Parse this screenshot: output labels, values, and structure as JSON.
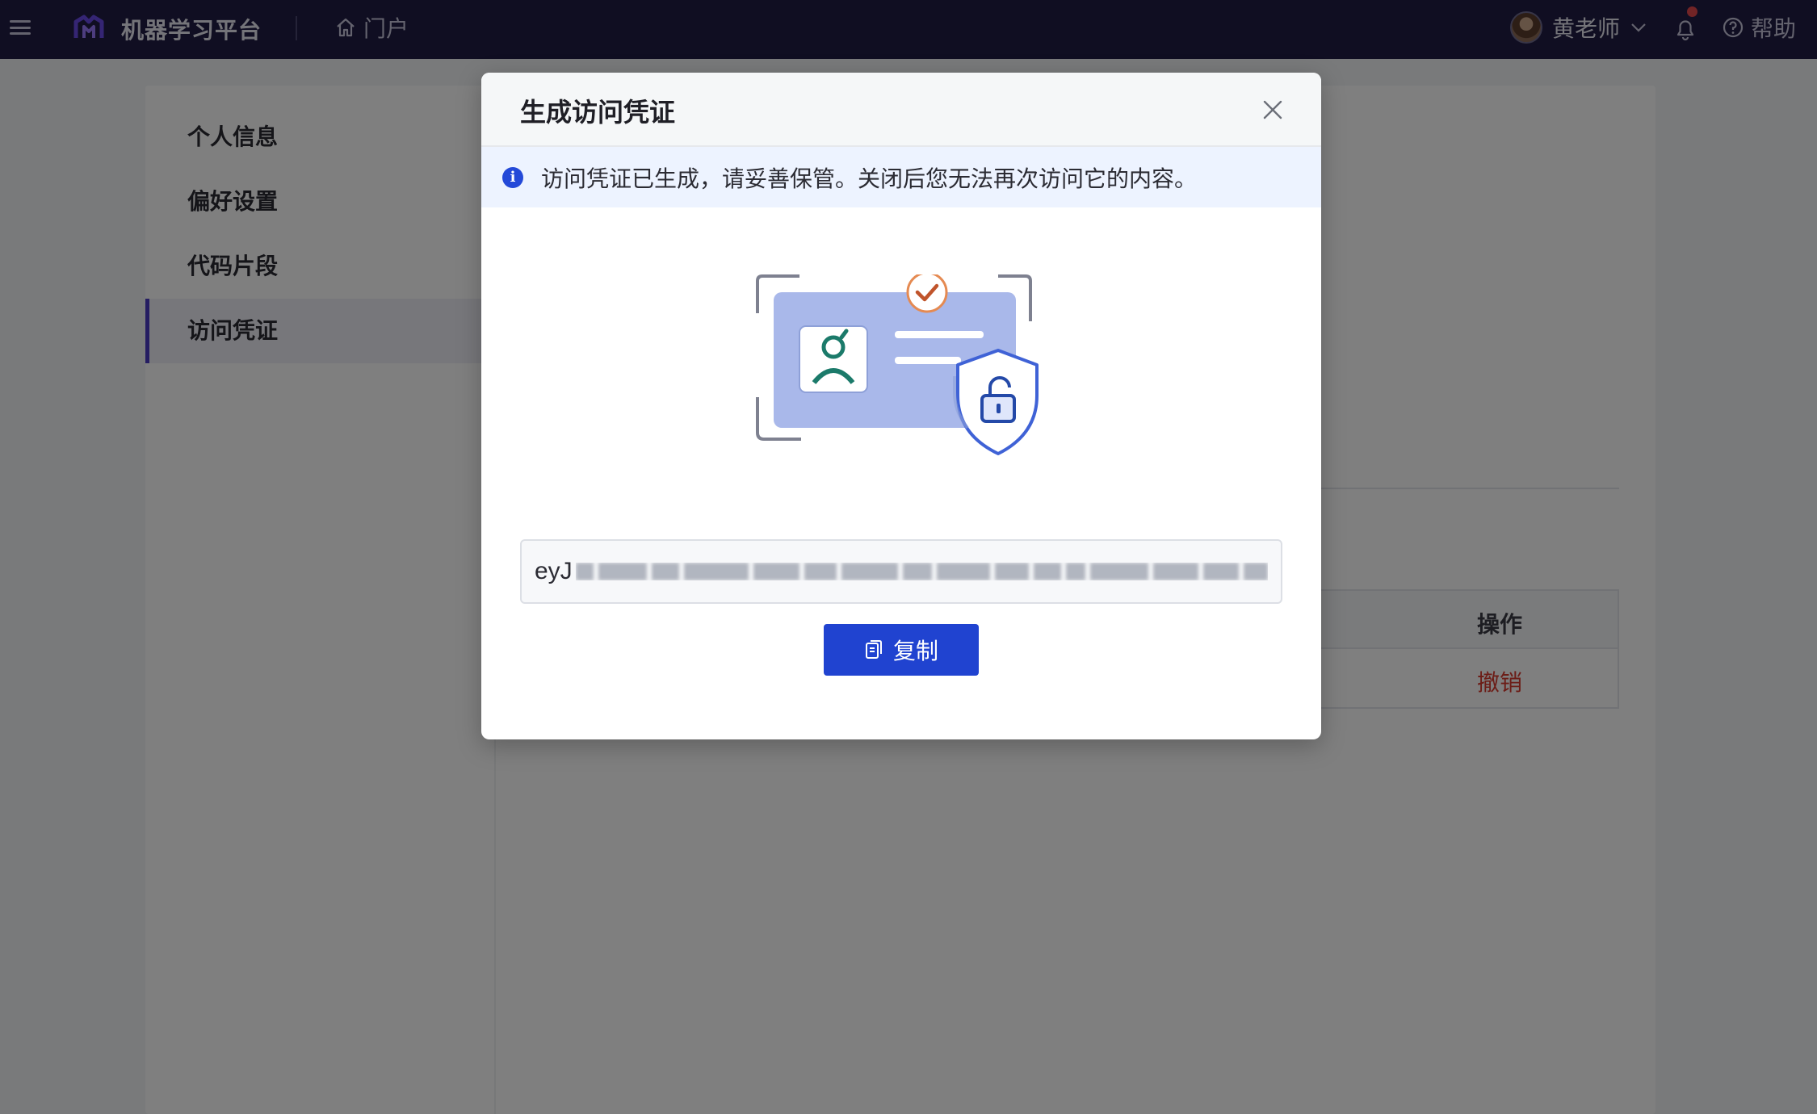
{
  "app": {
    "title": "机器学习平台",
    "portal_label": "门户",
    "user_name": "黄老师",
    "help_label": "帮助",
    "icons": {
      "menu": "menu-icon",
      "logo": "platform-logo-icon",
      "portal": "home-icon",
      "user_dropdown": "chevron-down-icon",
      "notifications": "bell-icon",
      "help": "question-circle-icon"
    },
    "colors": {
      "topbar": "#201c45",
      "primary": "#2043d0",
      "danger": "#d93b2f",
      "notification_dot": "#e5484d"
    }
  },
  "sidebar": {
    "items": [
      {
        "label": "个人信息"
      },
      {
        "label": "偏好设置"
      },
      {
        "label": "代码片段"
      },
      {
        "label": "访问凭证",
        "active": true
      }
    ]
  },
  "table": {
    "header_action": "操作",
    "rows": [
      {
        "action": "撤销"
      }
    ]
  },
  "modal": {
    "title": "生成访问凭证",
    "alert_text": "访问凭证已生成，请妥善保管。关闭后您无法再次访问它的内容。",
    "token_visible_prefix": "eyJ",
    "copy_label": "复制",
    "icons": {
      "close": "close-icon",
      "info": "info-icon",
      "copy": "copy-icon",
      "illustration": "credential-shield-illustration"
    }
  }
}
